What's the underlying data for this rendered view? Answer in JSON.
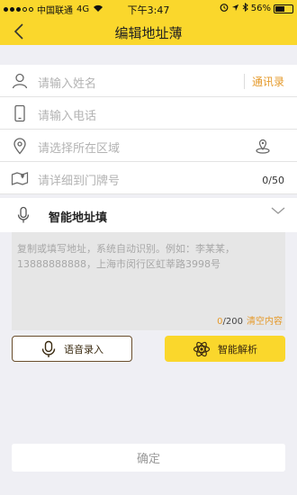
{
  "status": {
    "carrier": "中国联通",
    "network": "4G",
    "time": "下午3:47",
    "battery": "56%",
    "battery_level": 0.56
  },
  "nav": {
    "title": "编辑地址薄",
    "back_icon": "chevron-left-icon"
  },
  "form": {
    "name_placeholder": "请输入姓名",
    "contacts_label": "通讯录",
    "phone_placeholder": "请输入电话",
    "region_placeholder": "请选择所在区域",
    "detail_placeholder": "请详细到门牌号",
    "detail_counter": "0/50"
  },
  "smart": {
    "label": "智能地址填",
    "placeholder_line1": "复制或填写地址，系统自动识别。例如：李某某，",
    "placeholder_line2": "13888888888，上海市闵行区虹莘路3998号",
    "count_current": "0",
    "count_max": "/200",
    "clear_label": "清空内容",
    "voice_button": "语音录入",
    "parse_button": "智能解析"
  },
  "confirm_label": "确定",
  "colors": {
    "accent": "#fad72c",
    "orange": "#e59a2b",
    "brown": "#6a4e2c"
  }
}
